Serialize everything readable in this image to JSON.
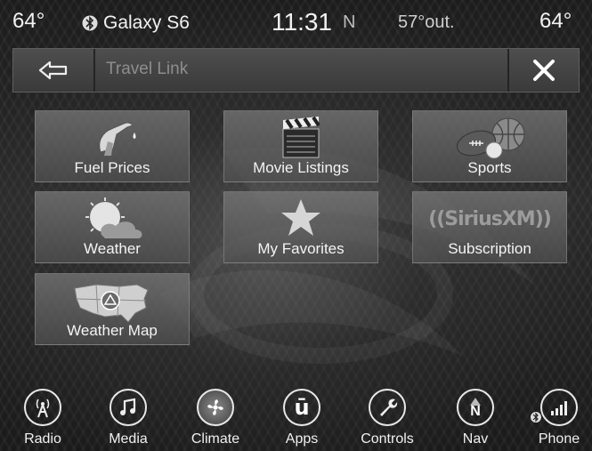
{
  "status": {
    "temp_left": "64°",
    "phone_name": "Galaxy S6",
    "time": "11:31",
    "compass": "N",
    "outside_temp": "57°out.",
    "temp_right": "64°"
  },
  "header": {
    "title": "Travel Link",
    "back_icon": "back-arrow-icon",
    "close_icon": "close-x-icon"
  },
  "tiles": [
    {
      "label": "Fuel Prices",
      "icon": "fuel-nozzle-icon"
    },
    {
      "label": "Movie Listings",
      "icon": "clapperboard-icon"
    },
    {
      "label": "Sports",
      "icon": "sports-balls-icon"
    },
    {
      "label": "Weather",
      "icon": "sun-cloud-icon"
    },
    {
      "label": "My Favorites",
      "icon": "star-icon"
    },
    {
      "label": "Subscription",
      "icon": "siriusxm-logo",
      "logo_text": "((SiriusXM))"
    },
    {
      "label": "Weather Map",
      "icon": "us-map-icon"
    }
  ],
  "nav": [
    {
      "label": "Radio",
      "icon": "radio-tower-icon"
    },
    {
      "label": "Media",
      "icon": "music-note-icon"
    },
    {
      "label": "Climate",
      "icon": "fan-icon"
    },
    {
      "label": "Apps",
      "icon": "uconnect-icon",
      "glyph": "ū"
    },
    {
      "label": "Controls",
      "icon": "wrench-icon"
    },
    {
      "label": "Nav",
      "icon": "compass-icon",
      "glyph": "N"
    },
    {
      "label": "Phone",
      "icon": "phone-signal-icon"
    }
  ],
  "colors": {
    "text": "#f2f2f2",
    "muted": "#8e8e8e",
    "tile": "#6e6e6e"
  }
}
